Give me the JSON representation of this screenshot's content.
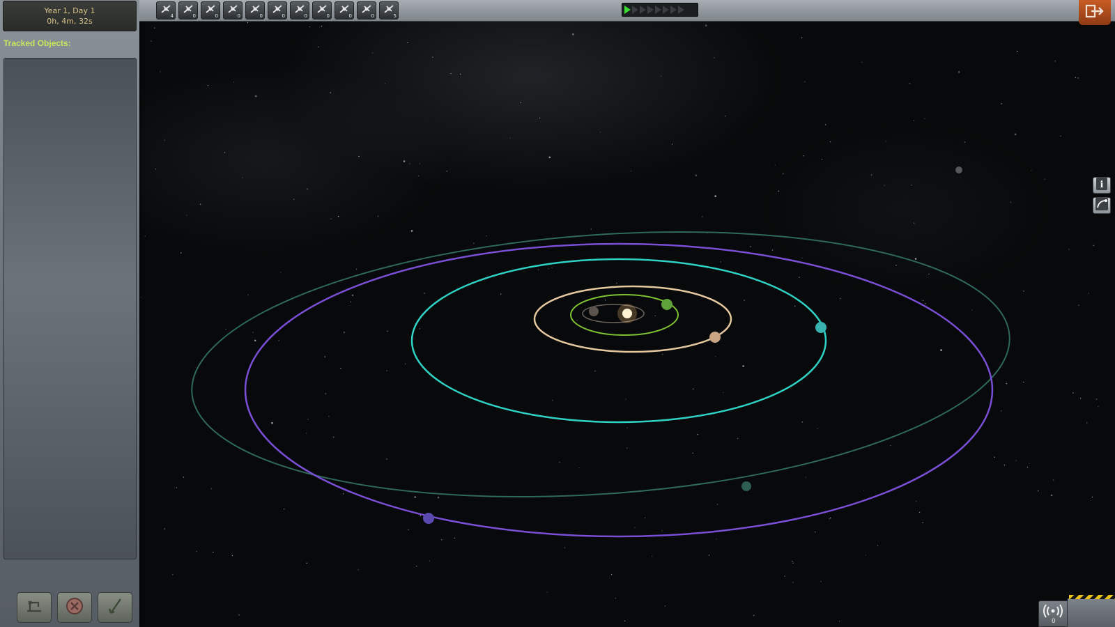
{
  "clock": {
    "date": "Year 1, Day 1",
    "time": "0h, 4m, 32s"
  },
  "tracked_objects": {
    "title": "Tracked Objects:",
    "items": []
  },
  "bottom_buttons": [
    {
      "name": "recover-button",
      "icon": "recover-icon"
    },
    {
      "name": "terminate-button",
      "icon": "terminate-icon"
    },
    {
      "name": "fly-button",
      "icon": "fly-icon"
    }
  ],
  "toolbar": {
    "filters": [
      {
        "name": "filter-debris",
        "icon": "debris-icon",
        "count": "4"
      },
      {
        "name": "filter-unknown",
        "icon": "unknown-object-icon",
        "count": "0"
      },
      {
        "name": "filter-probes",
        "icon": "probe-icon",
        "count": "0"
      },
      {
        "name": "filter-rovers",
        "icon": "rover-icon",
        "count": "0"
      },
      {
        "name": "filter-landers",
        "icon": "lander-icon",
        "count": "0"
      },
      {
        "name": "filter-ships",
        "icon": "ship-icon",
        "count": "0"
      },
      {
        "name": "filter-stations",
        "icon": "station-icon",
        "count": "0"
      },
      {
        "name": "filter-bases",
        "icon": "base-icon",
        "count": "0"
      },
      {
        "name": "filter-eva",
        "icon": "eva-icon",
        "count": "0"
      },
      {
        "name": "filter-flags",
        "icon": "flag-icon",
        "count": "0"
      },
      {
        "name": "filter-asteroids",
        "icon": "asteroid-icon",
        "count": "5"
      }
    ],
    "timewarp_levels": 8,
    "timewarp_active": 1
  },
  "right_buttons": [
    {
      "name": "info-button",
      "icon": "info-icon"
    },
    {
      "name": "orbit-button",
      "icon": "orbit-icon"
    }
  ],
  "comm": {
    "count": "0"
  },
  "colors": {
    "accent": "#c7e85a",
    "clock_text": "#d9c48a",
    "orbit_moho": "#e0c8a0",
    "orbit_eve": "#7fc334",
    "orbit_kerbin": "#2fd3c6",
    "orbit_duna": "#7a4fd6",
    "orbit_dres": "#2f6f5c"
  },
  "orbits": [
    {
      "name": "inner-orbit",
      "color": "#8a7f74",
      "planet": true
    },
    {
      "name": "green-orbit",
      "color": "#7fc334",
      "planet": true
    },
    {
      "name": "tan-orbit",
      "color": "#e7c9a0",
      "planet": true
    },
    {
      "name": "cyan-orbit",
      "color": "#2fd3c6",
      "planet": true
    },
    {
      "name": "purple-orbit",
      "color": "#7a4fd6",
      "planet": true
    },
    {
      "name": "outer-orbit",
      "color": "#2e6a58",
      "planet": true
    }
  ]
}
